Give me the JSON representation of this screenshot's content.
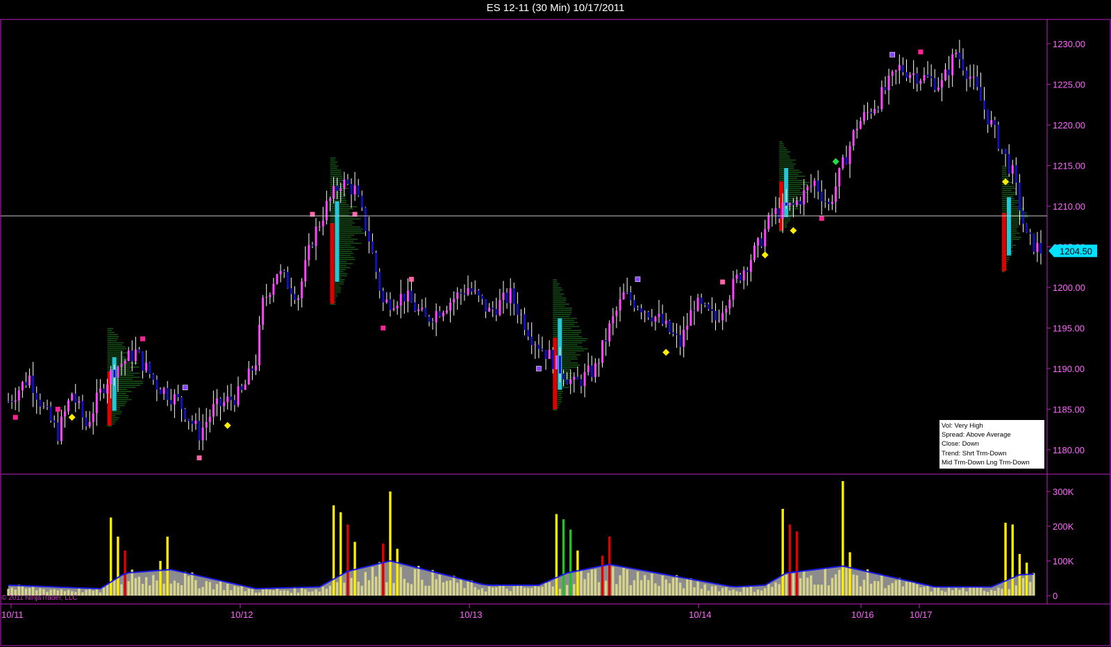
{
  "title": "ES 12-11 (30 Min)  10/17/2011",
  "colors": {
    "background": "#000000",
    "frame": "#c020c0",
    "axis_text": "#ff66ff",
    "bull_candle": "#ff44ff",
    "bear_candle": "#1010c0",
    "volume_avg_fill": "#8c8c8c",
    "volume_avg_line": "#1a1ae6",
    "volume_normal": "#d8d48a",
    "volume_high": "#ffee00",
    "volume_climax": "#e00000",
    "volume_green": "#22c022",
    "profile_green": "#1a5a1a",
    "profile_red": "#e00000",
    "profile_cyan": "#22c8d8",
    "last_price_tag": "#00e0ff",
    "reference_line": "#c8c8c8"
  },
  "price_tag": "1204.50",
  "info_box": {
    "lines": [
      "Vol: Very High",
      "Spread: Above Average",
      "Close: Down",
      "Trend:  Shrt Trm-Down",
      "Mid Trm-Down  Lng Trm-Down"
    ]
  },
  "copyright": "© 2011 NinjaTrader, LLC",
  "chart_data": [
    {
      "type": "candlestick",
      "instrument": "ES 12-11",
      "interval": "30 Min",
      "ylim": [
        1177,
        1233
      ],
      "y_ticks": [
        "1180.00",
        "1185.00",
        "1190.00",
        "1195.00",
        "1200.00",
        "1205.00",
        "1210.00",
        "1215.00",
        "1220.00",
        "1225.00",
        "1230.00"
      ],
      "x_ticks": [
        "10/11",
        "10/12",
        "10/13",
        "10/14",
        "10/16",
        "10/17"
      ],
      "last_price": 1204.5,
      "reference_line": 1208.8,
      "close_path": [
        {
          "x": 0,
          "y": 1186
        },
        {
          "x": 6,
          "y": 1189
        },
        {
          "x": 10,
          "y": 1185
        },
        {
          "x": 14,
          "y": 1182
        },
        {
          "x": 18,
          "y": 1187
        },
        {
          "x": 22,
          "y": 1183
        },
        {
          "x": 27,
          "y": 1188
        },
        {
          "x": 30,
          "y": 1190
        },
        {
          "x": 36,
          "y": 1192
        },
        {
          "x": 42,
          "y": 1188
        },
        {
          "x": 48,
          "y": 1186
        },
        {
          "x": 54,
          "y": 1182
        },
        {
          "x": 58,
          "y": 1185
        },
        {
          "x": 62,
          "y": 1186
        },
        {
          "x": 66,
          "y": 1187
        },
        {
          "x": 70,
          "y": 1191
        },
        {
          "x": 72,
          "y": 1198
        },
        {
          "x": 76,
          "y": 1202
        },
        {
          "x": 82,
          "y": 1199
        },
        {
          "x": 86,
          "y": 1206
        },
        {
          "x": 90,
          "y": 1210
        },
        {
          "x": 94,
          "y": 1213
        },
        {
          "x": 98,
          "y": 1212
        },
        {
          "x": 102,
          "y": 1206
        },
        {
          "x": 106,
          "y": 1198
        },
        {
          "x": 112,
          "y": 1199
        },
        {
          "x": 118,
          "y": 1196
        },
        {
          "x": 124,
          "y": 1198
        },
        {
          "x": 130,
          "y": 1200
        },
        {
          "x": 136,
          "y": 1197
        },
        {
          "x": 142,
          "y": 1199
        },
        {
          "x": 148,
          "y": 1194
        },
        {
          "x": 154,
          "y": 1191
        },
        {
          "x": 160,
          "y": 1188
        },
        {
          "x": 166,
          "y": 1190
        },
        {
          "x": 170,
          "y": 1195
        },
        {
          "x": 174,
          "y": 1199
        },
        {
          "x": 178,
          "y": 1198
        },
        {
          "x": 184,
          "y": 1196
        },
        {
          "x": 190,
          "y": 1193
        },
        {
          "x": 194,
          "y": 1198
        },
        {
          "x": 200,
          "y": 1196
        },
        {
          "x": 206,
          "y": 1201
        },
        {
          "x": 212,
          "y": 1205
        },
        {
          "x": 216,
          "y": 1209
        },
        {
          "x": 222,
          "y": 1210
        },
        {
          "x": 228,
          "y": 1213
        },
        {
          "x": 232,
          "y": 1210
        },
        {
          "x": 236,
          "y": 1215
        },
        {
          "x": 240,
          "y": 1220
        },
        {
          "x": 246,
          "y": 1223
        },
        {
          "x": 252,
          "y": 1227
        },
        {
          "x": 258,
          "y": 1226
        },
        {
          "x": 264,
          "y": 1225
        },
        {
          "x": 268,
          "y": 1229
        },
        {
          "x": 272,
          "y": 1226
        },
        {
          "x": 276,
          "y": 1222
        },
        {
          "x": 280,
          "y": 1218
        },
        {
          "x": 284,
          "y": 1214
        },
        {
          "x": 288,
          "y": 1206
        },
        {
          "x": 292,
          "y": 1204.5
        }
      ],
      "bars_total": 292
    },
    {
      "type": "bar",
      "name": "Volume",
      "ylim": [
        0,
        340000
      ],
      "y_ticks": [
        "300K",
        "200K",
        "100K",
        "0"
      ],
      "volume_spikes": [
        {
          "x": 29,
          "v": 225000,
          "kind": "high"
        },
        {
          "x": 31,
          "v": 170000,
          "kind": "high"
        },
        {
          "x": 33,
          "v": 130000,
          "kind": "climax"
        },
        {
          "x": 35,
          "v": 75000,
          "kind": "normal"
        },
        {
          "x": 43,
          "v": 100000,
          "kind": "high"
        },
        {
          "x": 45,
          "v": 170000,
          "kind": "high"
        },
        {
          "x": 92,
          "v": 260000,
          "kind": "high"
        },
        {
          "x": 94,
          "v": 240000,
          "kind": "high"
        },
        {
          "x": 96,
          "v": 205000,
          "kind": "climax"
        },
        {
          "x": 98,
          "v": 155000,
          "kind": "high"
        },
        {
          "x": 106,
          "v": 150000,
          "kind": "climax"
        },
        {
          "x": 108,
          "v": 300000,
          "kind": "high"
        },
        {
          "x": 110,
          "v": 135000,
          "kind": "high"
        },
        {
          "x": 155,
          "v": 235000,
          "kind": "high"
        },
        {
          "x": 157,
          "v": 220000,
          "kind": "green"
        },
        {
          "x": 159,
          "v": 190000,
          "kind": "green"
        },
        {
          "x": 161,
          "v": 130000,
          "kind": "high"
        },
        {
          "x": 168,
          "v": 115000,
          "kind": "climax"
        },
        {
          "x": 170,
          "v": 170000,
          "kind": "climax"
        },
        {
          "x": 219,
          "v": 250000,
          "kind": "high"
        },
        {
          "x": 221,
          "v": 205000,
          "kind": "climax"
        },
        {
          "x": 223,
          "v": 185000,
          "kind": "climax"
        },
        {
          "x": 236,
          "v": 330000,
          "kind": "high"
        },
        {
          "x": 238,
          "v": 125000,
          "kind": "high"
        },
        {
          "x": 282,
          "v": 210000,
          "kind": "high"
        },
        {
          "x": 284,
          "v": 205000,
          "kind": "high"
        },
        {
          "x": 286,
          "v": 120000,
          "kind": "high"
        },
        {
          "x": 288,
          "v": 95000,
          "kind": "high"
        }
      ],
      "average_path": [
        {
          "x": 0,
          "v": 30000
        },
        {
          "x": 26,
          "v": 20000
        },
        {
          "x": 33,
          "v": 65000
        },
        {
          "x": 46,
          "v": 75000
        },
        {
          "x": 70,
          "v": 20000
        },
        {
          "x": 88,
          "v": 25000
        },
        {
          "x": 96,
          "v": 70000
        },
        {
          "x": 108,
          "v": 100000
        },
        {
          "x": 135,
          "v": 30000
        },
        {
          "x": 150,
          "v": 30000
        },
        {
          "x": 158,
          "v": 65000
        },
        {
          "x": 170,
          "v": 90000
        },
        {
          "x": 205,
          "v": 25000
        },
        {
          "x": 214,
          "v": 30000
        },
        {
          "x": 220,
          "v": 65000
        },
        {
          "x": 236,
          "v": 85000
        },
        {
          "x": 262,
          "v": 25000
        },
        {
          "x": 278,
          "v": 25000
        },
        {
          "x": 286,
          "v": 60000
        },
        {
          "x": 290,
          "v": 62000
        }
      ]
    }
  ]
}
